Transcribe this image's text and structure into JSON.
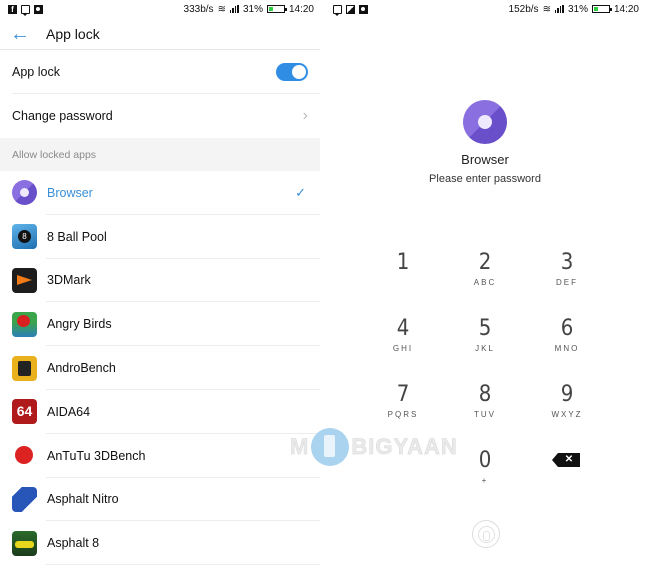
{
  "left_screen": {
    "status_bar": {
      "notification_icons": [
        "facebook-icon",
        "chat-icon",
        "photo-icon"
      ],
      "network_speed": "333b/s",
      "battery_percent": "31%",
      "battery_level": 0.31,
      "time": "14:20"
    },
    "app_bar": {
      "back_icon": "arrow-left",
      "title": "App lock"
    },
    "settings": {
      "app_lock_label": "App lock",
      "app_lock_enabled": true,
      "change_password_label": "Change password"
    },
    "section_header": "Allow locked apps",
    "apps": [
      {
        "name": "Browser",
        "icon": "browser-icon",
        "locked": true
      },
      {
        "name": "8 Ball Pool",
        "icon": "8-ball-pool-icon",
        "locked": false
      },
      {
        "name": "3DMark",
        "icon": "3dmark-icon",
        "locked": false
      },
      {
        "name": "Angry Birds",
        "icon": "angry-birds-icon",
        "locked": false
      },
      {
        "name": "AndroBench",
        "icon": "androbench-icon",
        "locked": false
      },
      {
        "name": "AIDA64",
        "icon": "aida64-icon",
        "icon_text": "64",
        "locked": false
      },
      {
        "name": "AnTuTu 3DBench",
        "icon": "antutu-icon",
        "locked": false
      },
      {
        "name": "Asphalt Nitro",
        "icon": "asphalt-nitro-icon",
        "locked": false
      },
      {
        "name": "Asphalt 8",
        "icon": "asphalt-8-icon",
        "locked": false
      }
    ],
    "check_glyph": "✓",
    "chevron_glyph": "›"
  },
  "right_screen": {
    "status_bar": {
      "notification_icons": [
        "chat-icon",
        "image-icon",
        "photo-icon"
      ],
      "network_speed": "152b/s",
      "battery_percent": "31%",
      "battery_level": 0.31,
      "time": "14:20"
    },
    "locked_app_name": "Browser",
    "prompt": "Please enter password",
    "keypad": [
      {
        "digit": "1",
        "letters": ""
      },
      {
        "digit": "2",
        "letters": "ABC"
      },
      {
        "digit": "3",
        "letters": "DEF"
      },
      {
        "digit": "4",
        "letters": "GHI"
      },
      {
        "digit": "5",
        "letters": "JKL"
      },
      {
        "digit": "6",
        "letters": "MNO"
      },
      {
        "digit": "7",
        "letters": "PQRS"
      },
      {
        "digit": "8",
        "letters": "TUV"
      },
      {
        "digit": "9",
        "letters": "WXYZ"
      },
      {
        "digit": "0",
        "letters": "+"
      }
    ],
    "delete_glyph": "✕"
  },
  "watermark": {
    "left_text": "M",
    "right_text": "BIGYAAN"
  }
}
